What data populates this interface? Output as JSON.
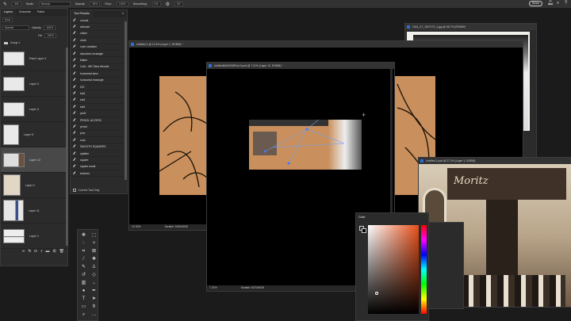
{
  "options_bar": {
    "brush_size": "300",
    "mode_label": "Mode:",
    "mode": "Normal",
    "opacity_label": "Opacity:",
    "opacity": "50%",
    "flow_label": "Flow:",
    "flow": "100%",
    "smoothing_label": "Smoothing:",
    "smoothing": "0%",
    "angle": "90°",
    "share": "Share"
  },
  "layers_panel": {
    "tabs": [
      "Layers",
      "Channels",
      "Paths"
    ],
    "kind": "Kind",
    "blend": "Normal",
    "opacity_label": "Opacity:",
    "opacity": "100%",
    "fill_label": "Fill:",
    "fill": "100%",
    "group": "Group 1",
    "layers": [
      "Paint Layer 3",
      "Layer 4",
      "Layer 3",
      "Layer 5",
      "Layer 12",
      "Layer 2",
      "Layer 11",
      "Layer 1"
    ],
    "selected": "Layer 12"
  },
  "tool_presets": {
    "title": "Tool Presets",
    "items": [
      "rounds",
      "airbrush",
      "chisel",
      "circle",
      "color variation",
      "dissolved rectangle",
      "flatten",
      "Cold - WR Stew Wrestle",
      "horizontal stew",
      "horizontal rectangle",
      "ICE",
      "kat1",
      "kat1",
      "kat1",
      "ped1",
      "PENCIL ACCESS",
      "pencil",
      "pow",
      "rods",
      "SMOOTH SQUARES",
      "splatter",
      "square",
      "square small",
      "textures"
    ],
    "current_tool_only": "Current Tool Only"
  },
  "documents": [
    {
      "title": "Untitled-1 @ 12.4% (Layer 1, RGB/8) *",
      "zoom": "12.32%",
      "info": "Scratch: 6240/4030"
    },
    {
      "title": "Untitled5A0H008Fed-3.psd @ 7.21% (Layer 12, RGB/8) *",
      "zoom": "7.21%",
      "info": "Scratch: 6270/4030"
    },
    {
      "title": "1941_47_1927173_1.jpg @ 66.7% (RGB/8*)"
    },
    {
      "title": "Untitled-1.psd @ 27.1% (Layer 1, RGB/8)",
      "sign_text": "Moritz"
    }
  ],
  "color_panel": {
    "title": "Color",
    "hue_color": "#e8501a"
  },
  "colors": {
    "accent": "#2a6fd1",
    "sketch_bg": "#c98f5c"
  }
}
